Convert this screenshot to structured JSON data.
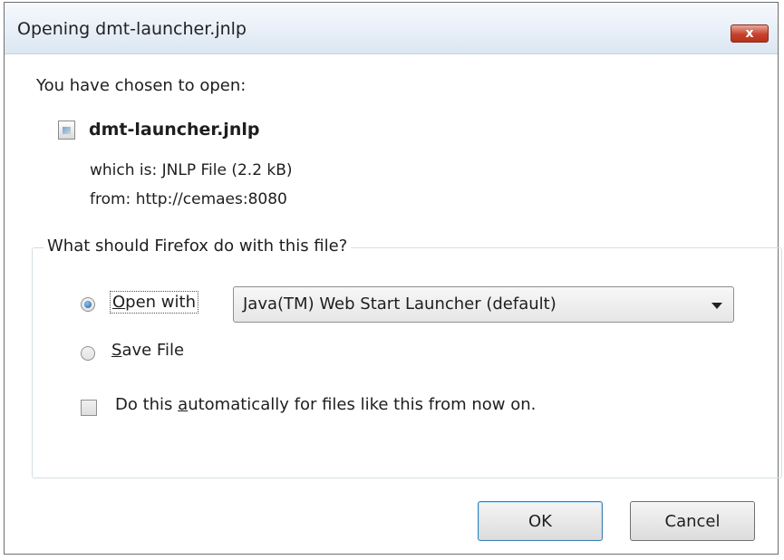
{
  "window": {
    "title": "Opening dmt-launcher.jnlp",
    "close_symbol": "x"
  },
  "content": {
    "intro": "You have chosen to open:",
    "file_icon": "file-icon",
    "filename": "dmt-launcher.jnlp",
    "which_is": "which is:  JNLP File (2.2 kB)",
    "from": "from:  http://cemaes:8080"
  },
  "action_group": {
    "label": "What should Firefox do with this file?",
    "open_with": {
      "label_prefix": "",
      "underline": "O",
      "label_suffix": "pen with",
      "selected": true
    },
    "application_select": {
      "value": "Java(TM) Web Start Launcher (default)"
    },
    "save_file": {
      "underline": "S",
      "label_suffix": "ave File",
      "selected": false
    },
    "auto_checkbox": {
      "label_prefix": "Do this ",
      "underline": "a",
      "label_suffix": "utomatically for files like this from now on.",
      "checked": false
    }
  },
  "buttons": {
    "ok": "OK",
    "cancel": "Cancel"
  },
  "colors": {
    "close_button": "#c6422c",
    "radio_selected": "#1b5fa3"
  }
}
